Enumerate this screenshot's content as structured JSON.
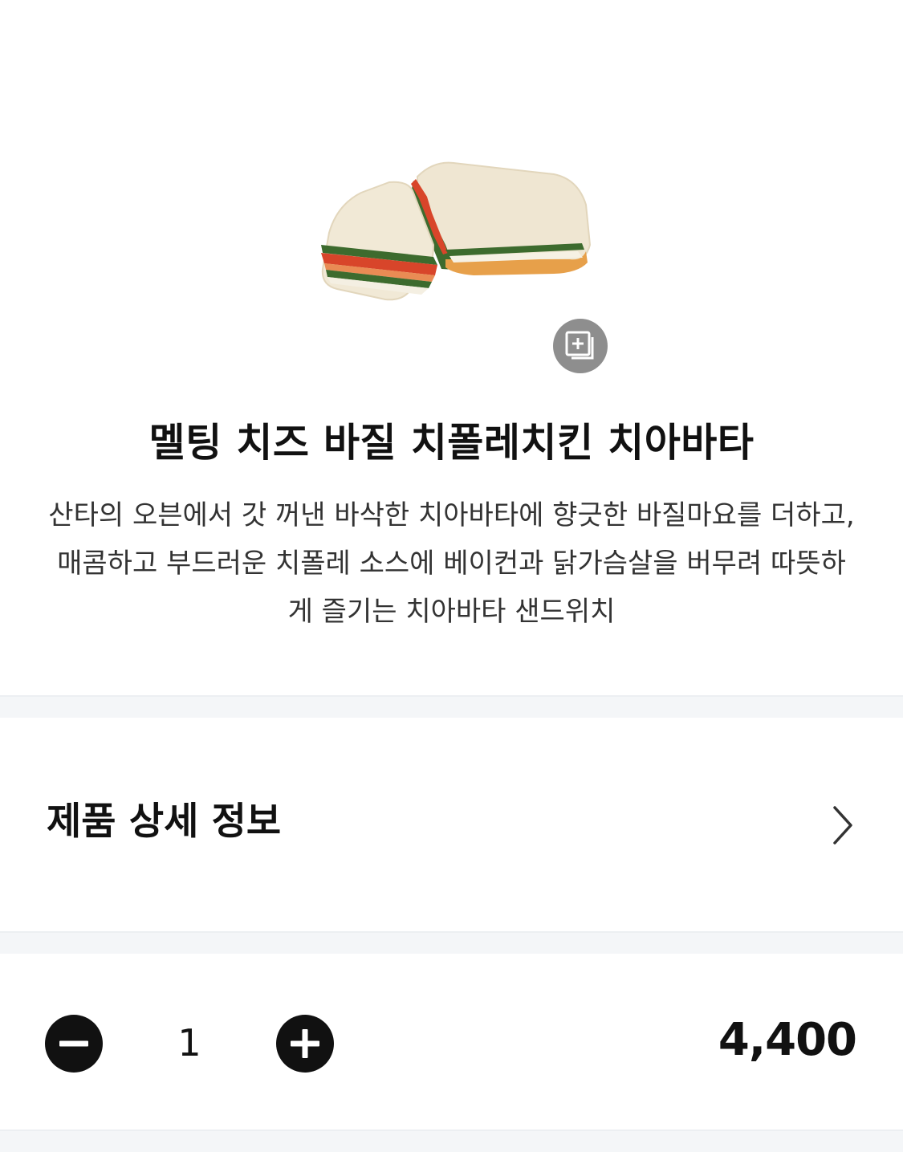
{
  "product": {
    "image_alt": "sandwich",
    "zoom_icon": "zoom-gallery-icon",
    "title": "멜팅 치즈 바질 치폴레치킨 치아바타",
    "description": "산타의 오븐에서 갓 꺼낸 바삭한 치아바타에 향긋한 바질마요를 더하고, 매콤하고 부드러운 치폴레 소스에 베이컨과 닭가슴살을 버무려 따뜻하게 즐기는 치아바타 샌드위치"
  },
  "detail": {
    "label": "제품 상세 정보",
    "icon": "chevron-right-icon"
  },
  "order": {
    "minus_icon": "minus-icon",
    "plus_icon": "plus-icon",
    "quantity": "1",
    "price": "4,400"
  },
  "colors": {
    "zoom_button": "#8e8e8e",
    "divider": "#f4f6f8",
    "text": "#111111",
    "body_text": "#333333"
  }
}
